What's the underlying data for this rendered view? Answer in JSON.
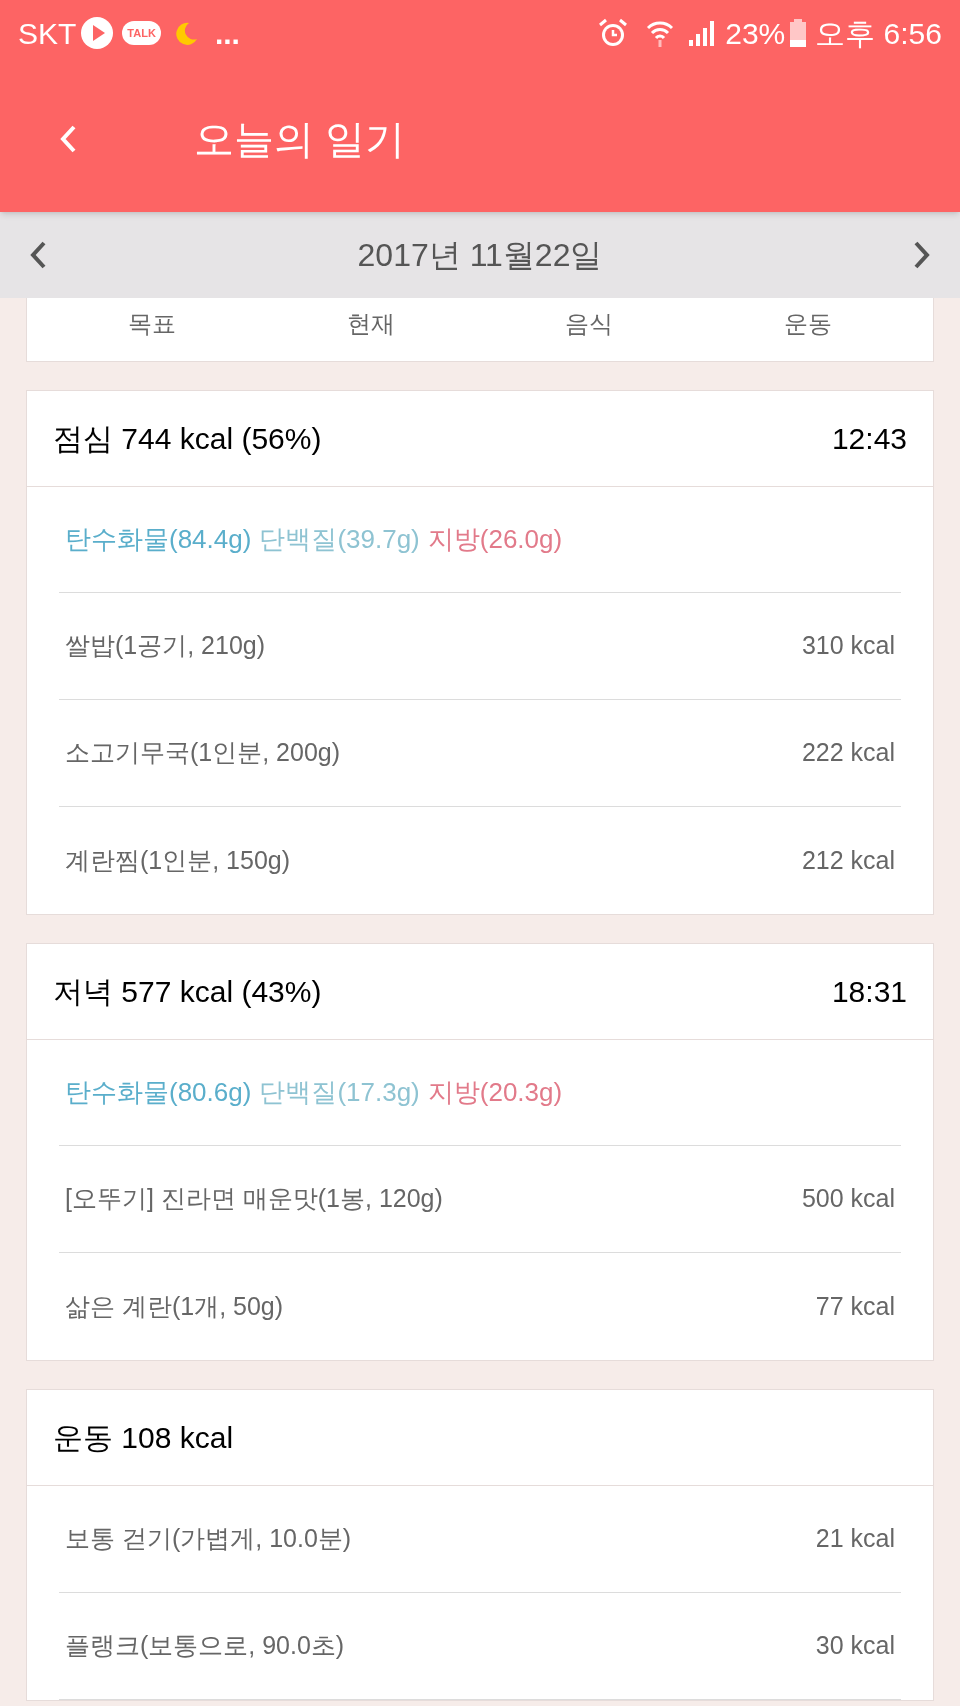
{
  "status_bar": {
    "carrier": "SKT",
    "chat_badge": "TALK",
    "more": "...",
    "battery": "23%",
    "time": "오후 6:56"
  },
  "header": {
    "title": "오늘의 일기"
  },
  "date_bar": {
    "date": "2017년 11월22일"
  },
  "summary_tabs": [
    "목표",
    "현재",
    "음식",
    "운동"
  ],
  "sections": [
    {
      "kind": "meal",
      "title": "점심 744 kcal (56%)",
      "time": "12:43",
      "macros": [
        {
          "label": "탄수화물(84.4g)",
          "color": "#5aaecb"
        },
        {
          "label": "단백질(39.7g)",
          "color": "#8ec3d2"
        },
        {
          "label": "지방(26.0g)",
          "color": "#e27a8a"
        }
      ],
      "items": [
        {
          "name": "쌀밥(1공기, 210g)",
          "kcal": "310 kcal"
        },
        {
          "name": "소고기무국(1인분, 200g)",
          "kcal": "222 kcal"
        },
        {
          "name": "계란찜(1인분, 150g)",
          "kcal": "212 kcal"
        }
      ]
    },
    {
      "kind": "meal",
      "title": "저녁 577 kcal (43%)",
      "time": "18:31",
      "macros": [
        {
          "label": "탄수화물(80.6g)",
          "color": "#5aaecb"
        },
        {
          "label": "단백질(17.3g)",
          "color": "#8ec3d2"
        },
        {
          "label": "지방(20.3g)",
          "color": "#e27a8a"
        }
      ],
      "items": [
        {
          "name": "[오뚜기] 진라면 매운맛(1봉, 120g)",
          "kcal": "500 kcal"
        },
        {
          "name": "삶은 계란(1개, 50g)",
          "kcal": "77 kcal"
        }
      ]
    },
    {
      "kind": "exercise",
      "title": "운동 108 kcal",
      "items": [
        {
          "name": "보통 걷기(가볍게, 10.0분)",
          "kcal": "21 kcal"
        },
        {
          "name": "플랭크(보통으로, 90.0초)",
          "kcal": "30 kcal"
        }
      ]
    }
  ]
}
